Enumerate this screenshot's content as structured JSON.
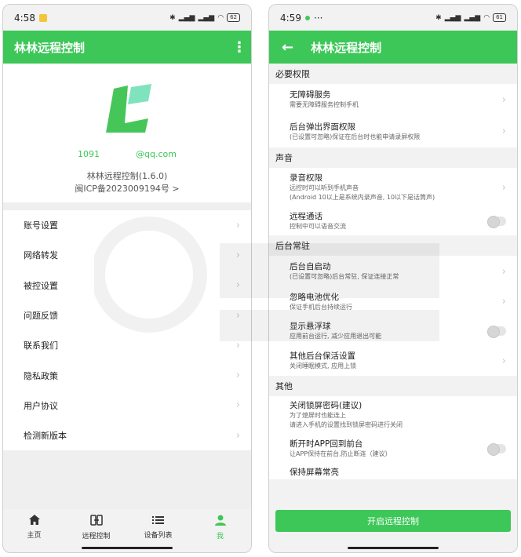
{
  "left": {
    "status": {
      "time": "4:58",
      "battery": "62"
    },
    "app_bar": {
      "title": "林林远程控制"
    },
    "profile": {
      "account_prefix": "1091",
      "account_suffix": "@qq.com",
      "version": "林林远程控制(1.6.0)",
      "icp": "闽ICP备2023009194号 >"
    },
    "menu": [
      {
        "label": "账号设置"
      },
      {
        "label": "网络转发"
      },
      {
        "label": "被控设置"
      },
      {
        "label": "问题反馈"
      },
      {
        "label": "联系我们"
      },
      {
        "label": "隐私政策"
      },
      {
        "label": "用户协议"
      },
      {
        "label": "检测新版本"
      }
    ],
    "tabs": [
      {
        "label": "主页",
        "icon": "home-icon"
      },
      {
        "label": "远程控制",
        "icon": "remote-icon"
      },
      {
        "label": "设备列表",
        "icon": "list-icon"
      },
      {
        "label": "我",
        "icon": "person-icon"
      }
    ]
  },
  "right": {
    "status": {
      "time": "4:59",
      "battery": "61"
    },
    "app_bar": {
      "title": "林林远程控制"
    },
    "sections": {
      "required": "必要权限",
      "sound": "声音",
      "background": "后台常驻",
      "other": "其他"
    },
    "items": {
      "accessibility": {
        "title": "无障碍服务",
        "sub": "需要无障碍服务控制手机"
      },
      "popup": {
        "title": "后台弹出界面权限",
        "sub": "(已设置可忽略)保证在后台时也能申请录屏权限"
      },
      "record": {
        "title": "录音权限",
        "sub": "远控时可以听到手机声音",
        "sub2": "(Android 10以上是系统内录声音, 10以下是话筒声)"
      },
      "voice": {
        "title": "远程通话",
        "sub": "控制中可以语音交流"
      },
      "autostart": {
        "title": "后台自启动",
        "sub": "(已设置可忽略)后台常驻, 保证连接正常"
      },
      "battery": {
        "title": "忽略电池优化",
        "sub": "保证手机后台持续运行"
      },
      "float": {
        "title": "显示悬浮球",
        "sub": "应用前台运行, 减少应用退出可能"
      },
      "keepalive": {
        "title": "其他后台保活设置",
        "sub": "关闭睡眠模式, 应用上锁"
      },
      "lockpwd": {
        "title": "关闭锁屏密码(建议)",
        "sub": "为了熄屏时也能连上",
        "sub2": "请进入手机的设置找到锁屏密码进行关闭"
      },
      "foreground": {
        "title": "断开时APP回到前台",
        "sub": "让APP保持在前台,防止断连（建议）"
      },
      "keepscreen": {
        "title": "保持屏幕常亮"
      }
    },
    "start_button": "开启远程控制"
  },
  "colors": {
    "accent": "#3dc758",
    "logo_dark": "#46c659",
    "logo_light": "#7fe3be"
  }
}
